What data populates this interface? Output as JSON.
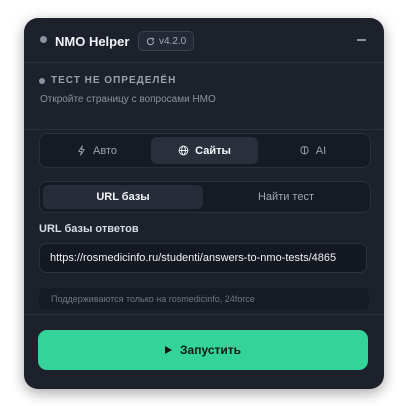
{
  "header": {
    "title": "NMO Helper",
    "version": "v4.2.0"
  },
  "status": {
    "title": "ТЕСТ НЕ ОПРЕДЕЛЁН",
    "subtitle": "Откройте страницу с вопросами НМО"
  },
  "mode_tabs": [
    {
      "label": "Авто",
      "icon": "lightning-icon"
    },
    {
      "label": "Сайты",
      "icon": "globe-icon",
      "active": true
    },
    {
      "label": "AI",
      "icon": "brain-icon"
    }
  ],
  "sub_tabs": [
    {
      "label": "URL базы",
      "active": true
    },
    {
      "label": "Найти тест"
    }
  ],
  "url_field": {
    "label": "URL базы ответов",
    "value": "https://rosmedicinfo.ru/studenti/answers-to-nmo-tests/4865"
  },
  "hint": "Поддерживаются только на rosmedicinfo, 24force",
  "run_button": {
    "label": "Запустить",
    "icon": "play-icon"
  },
  "colors": {
    "panel_bg": "#1c212b",
    "accent": "#34d399",
    "text": "#e6e9ef"
  }
}
